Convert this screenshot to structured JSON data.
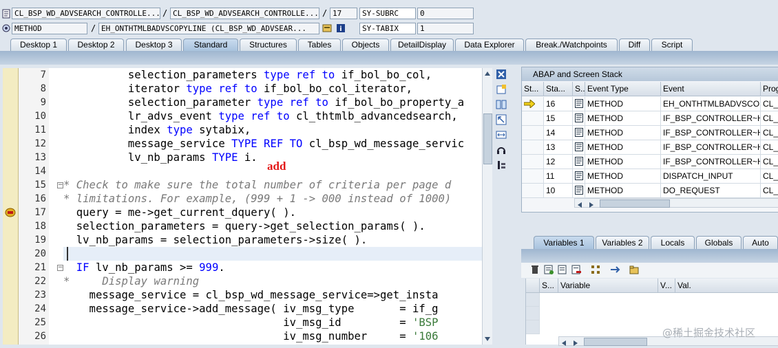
{
  "header": {
    "row1": {
      "program": "CL_BSP_WD_ADVSEARCH_CONTROLLE...",
      "include": "CL_BSP_WD_ADVSEARCH_CONTROLLE...",
      "line": "17",
      "var_name": "SY-SUBRC",
      "var_value": "0"
    },
    "row2": {
      "event_type": "METHOD",
      "event": "EH_ONTHTMLBADVSCOPYLINE (CL_BSP_WD_ADVSEAR...",
      "var_name": "SY-TABIX",
      "var_value": "1"
    },
    "separator": "/"
  },
  "tabs": [
    "Desktop 1",
    "Desktop 2",
    "Desktop 3",
    "Standard",
    "Structures",
    "Tables",
    "Objects",
    "DetailDisplay",
    "Data Explorer",
    "Break./Watchpoints",
    "Diff",
    "Script"
  ],
  "active_tab": "Standard",
  "code": {
    "line_numbers": [
      "7",
      "8",
      "9",
      "10",
      "11",
      "12",
      "13",
      "14",
      "15",
      "16",
      "17",
      "18",
      "19",
      "20",
      "21",
      "22",
      "23",
      "24",
      "25",
      "26"
    ],
    "lines": [
      [
        {
          "t": "          selection_parameters "
        },
        {
          "t": "type ref to",
          "k": "kw"
        },
        {
          "t": " if_bol_bo_col,"
        }
      ],
      [
        {
          "t": "          iterator "
        },
        {
          "t": "type ref to",
          "k": "kw"
        },
        {
          "t": " if_bol_bo_col_iterator,"
        }
      ],
      [
        {
          "t": "          selection_parameter "
        },
        {
          "t": "type ref to",
          "k": "kw"
        },
        {
          "t": " if_bol_bo_property_a"
        }
      ],
      [
        {
          "t": "          lr_advs_event "
        },
        {
          "t": "type ref to",
          "k": "kw"
        },
        {
          "t": " cl_thtmlb_advancedsearch,"
        }
      ],
      [
        {
          "t": "          index "
        },
        {
          "t": "type",
          "k": "kw"
        },
        {
          "t": " sytabix,"
        }
      ],
      [
        {
          "t": "          message_service "
        },
        {
          "t": "TYPE REF TO",
          "k": "kw"
        },
        {
          "t": " cl_bsp_wd_message_servic"
        }
      ],
      [
        {
          "t": "          lv_nb_params "
        },
        {
          "t": "TYPE",
          "k": "kw"
        },
        {
          "t": " i."
        }
      ],
      [
        {
          "t": ""
        }
      ],
      [
        {
          "t": "* Check to make sure the total number of criteria per page d",
          "k": "cm"
        }
      ],
      [
        {
          "t": "* limitations. For example, (999 + 1 -> 000 instead of 1000)",
          "k": "cm"
        }
      ],
      [
        {
          "t": "  query = me->get_current_dquery( )."
        }
      ],
      [
        {
          "t": "  selection_parameters = query->get_selection_params( )."
        }
      ],
      [
        {
          "t": "  lv_nb_params = selection_parameters->size( )."
        }
      ],
      [
        {
          "t": ""
        }
      ],
      [
        {
          "t": "  "
        },
        {
          "t": "IF",
          "k": "kw"
        },
        {
          "t": " lv_nb_params >= "
        },
        {
          "t": "999",
          "k": "kw"
        },
        {
          "t": "."
        }
      ],
      [
        {
          "t": "*     Display warning",
          "k": "cm"
        }
      ],
      [
        {
          "t": "    message_service = cl_bsp_wd_message_service=>get_insta"
        }
      ],
      [
        {
          "t": "    message_service->add_message( iv_msg_type       = if_g"
        }
      ],
      [
        {
          "t": "                                  iv_msg_id         = "
        },
        {
          "t": "'BSP",
          "k": "str"
        }
      ],
      [
        {
          "t": "                                  iv_msg_number     = "
        },
        {
          "t": "'106",
          "k": "str"
        }
      ]
    ]
  },
  "annotation": "add",
  "stack": {
    "title": "ABAP and Screen Stack",
    "columns": [
      "St...",
      "Sta...",
      "S...",
      "Event Type",
      "Event",
      "Prog"
    ],
    "rows": [
      {
        "level": "16",
        "event_type": "METHOD",
        "event": "EH_ONTHTMLBADVSCO...",
        "prog": "CL_E"
      },
      {
        "level": "15",
        "event_type": "METHOD",
        "event": "IF_BSP_CONTROLLER~H...",
        "prog": "CL_E"
      },
      {
        "level": "14",
        "event_type": "METHOD",
        "event": "IF_BSP_CONTROLLER~H...",
        "prog": "CL_E"
      },
      {
        "level": "13",
        "event_type": "METHOD",
        "event": "IF_BSP_CONTROLLER~H...",
        "prog": "CL_E"
      },
      {
        "level": "12",
        "event_type": "METHOD",
        "event": "IF_BSP_CONTROLLER~H...",
        "prog": "CL_E"
      },
      {
        "level": "11",
        "event_type": "METHOD",
        "event": "DISPATCH_INPUT",
        "prog": "CL_E"
      },
      {
        "level": "10",
        "event_type": "METHOD",
        "event": "DO_REQUEST",
        "prog": "CL_E"
      }
    ]
  },
  "var_tabs": [
    "Variables 1",
    "Variables 2",
    "Locals",
    "Globals",
    "Auto"
  ],
  "active_var_tab": "Variables 1",
  "vars": {
    "columns": [
      "S...",
      "Variable",
      "V...",
      "Val."
    ]
  },
  "watermark": "@稀土掘金技术社区",
  "colors": {
    "keyword": "#0000ff",
    "comment": "#7a7a7a",
    "annotation": "#e31818",
    "active_tab": "#b4cbe3"
  }
}
